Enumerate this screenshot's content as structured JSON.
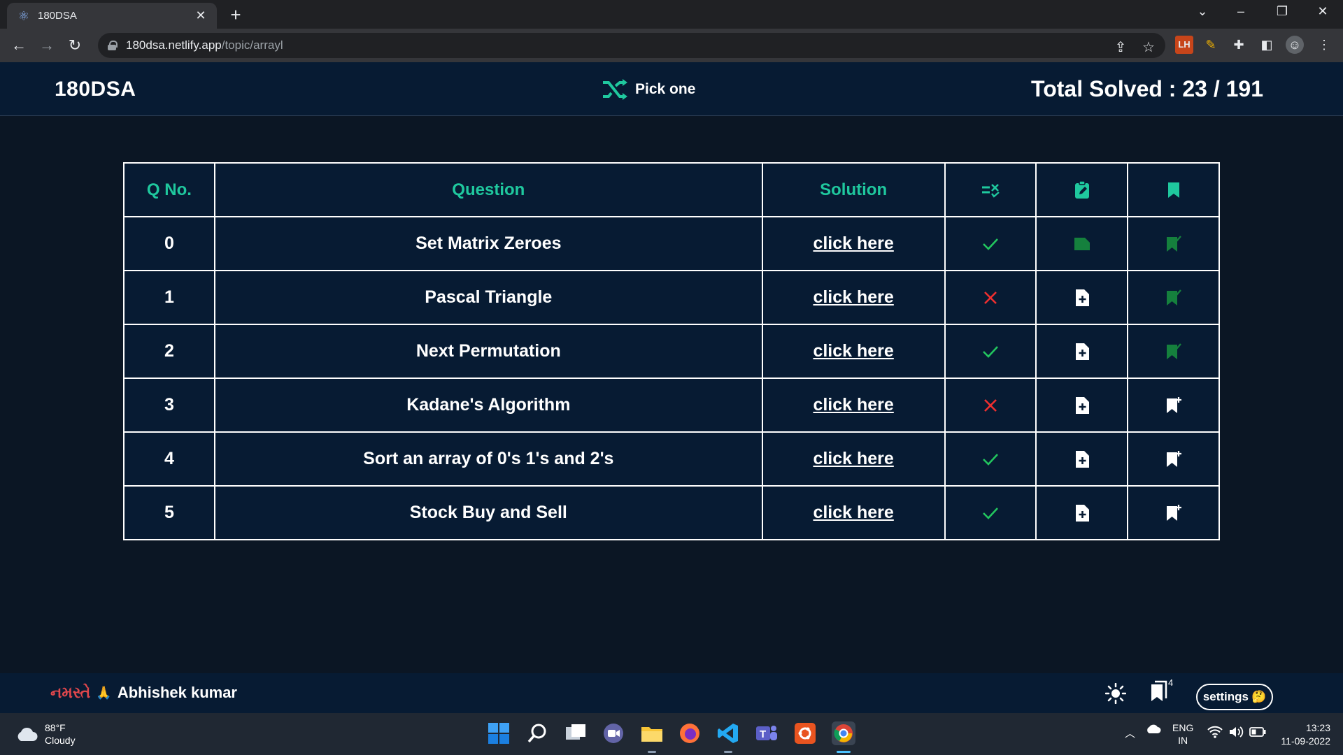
{
  "browser": {
    "tab_title": "180DSA",
    "url_host": "180dsa.netlify.app",
    "url_path": "/topic/arrayl"
  },
  "header": {
    "brand": "180DSA",
    "pick_label": "Pick one",
    "total_solved": "Total Solved : 23 / 191"
  },
  "table": {
    "headers": {
      "qno": "Q No.",
      "question": "Question",
      "solution": "Solution"
    },
    "header_icons": [
      "done-status-icon",
      "notes-icon",
      "bookmark-icon"
    ],
    "rows": [
      {
        "no": "0",
        "question": "Set Matrix Zeroes",
        "solution": "click here",
        "done": true,
        "note": "has-note",
        "bookmarked": true
      },
      {
        "no": "1",
        "question": "Pascal Triangle",
        "solution": "click here",
        "done": false,
        "note": "add-note",
        "bookmarked": true
      },
      {
        "no": "2",
        "question": "Next Permutation",
        "solution": "click here",
        "done": true,
        "note": "add-note",
        "bookmarked": true
      },
      {
        "no": "3",
        "question": "Kadane's Algorithm",
        "solution": "click here",
        "done": false,
        "note": "add-note",
        "bookmarked": false
      },
      {
        "no": "4",
        "question": "Sort an array of 0's 1's and 2's",
        "solution": "click here",
        "done": true,
        "note": "add-note",
        "bookmarked": false
      },
      {
        "no": "5",
        "question": "Stock Buy and Sell",
        "solution": "click here",
        "done": true,
        "note": "add-note",
        "bookmarked": false
      }
    ]
  },
  "footer": {
    "greeting": "નમસ્તે",
    "greeting_emoji": "🙏",
    "user_name": "Abhishek kumar",
    "notification_count": "4",
    "settings_label": "settings",
    "settings_emoji": "🤔"
  },
  "taskbar": {
    "temperature": "88°F",
    "condition": "Cloudy",
    "lang_line1": "ENG",
    "lang_line2": "IN",
    "time": "13:23",
    "date": "11-09-2022"
  },
  "colors": {
    "accent": "#1fc89e",
    "done": "#22c55e",
    "not_done": "#ef2f2f",
    "bookmarked": "#15803d",
    "background": "#071b33"
  }
}
